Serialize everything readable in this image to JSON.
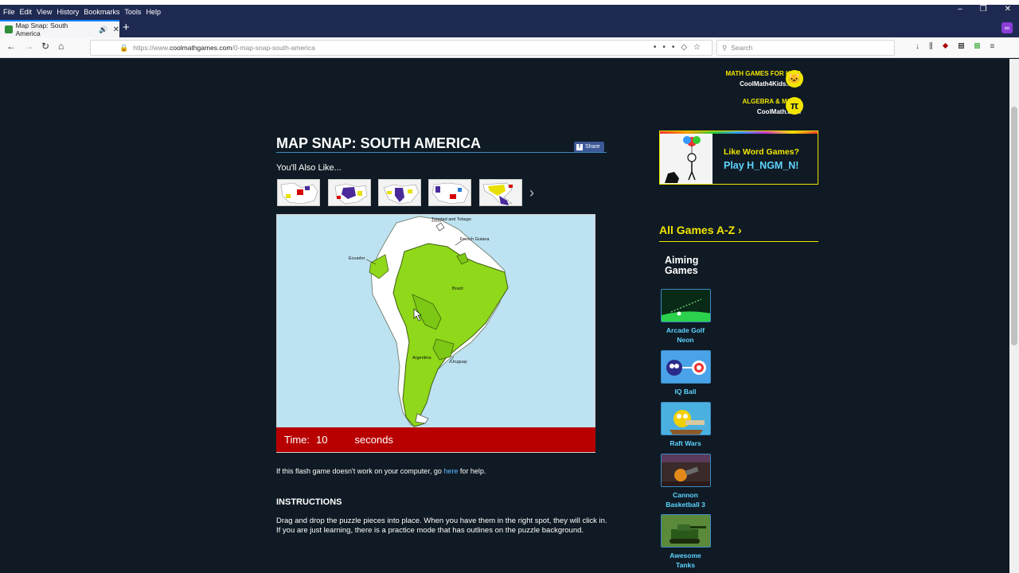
{
  "browser": {
    "menu": [
      "File",
      "Edit",
      "View",
      "History",
      "Bookmarks",
      "Tools",
      "Help"
    ],
    "tab_title": "Map Snap: South America",
    "url_prefix": "https://www.",
    "url_host": "coolmathgames.com",
    "url_path": "/0-map-snap-south-america",
    "search_placeholder": "Search"
  },
  "promos": {
    "kids_title": "MATH GAMES FOR KIDS",
    "kids_site": "CoolMath4Kids.com",
    "algebra_title": "ALGEBRA & MORE",
    "algebra_site": "CoolMath.com",
    "pi_symbol": "π"
  },
  "game": {
    "title": "MAP SNAP: SOUTH AMERICA",
    "share_label": "Share",
    "also_like": "You'll Also Like...",
    "map_labels": {
      "trinidad": "Trinidad and Tobago",
      "french_guiana": "French Guiana",
      "ecuador": "Ecuador",
      "brazil": "Brazil",
      "argentina": "Argentina",
      "uruguay": "Uruguay"
    },
    "timer_label": "Time:",
    "timer_value": "10",
    "timer_unit": "seconds",
    "help_text_before": "If this flash game doesn't work on your computer, go ",
    "help_link": "here",
    "help_text_after": " for help.",
    "instructions_heading": "INSTRUCTIONS",
    "instructions_1": "Drag and drop the puzzle pieces into place. When you have them in the right spot, they will click in.",
    "instructions_2": "If you are just learning, there is a practice mode that has outlines on the puzzle background."
  },
  "ad": {
    "line1": "Like Word Games?",
    "line2": "Play H_NGM_N!"
  },
  "sidebar": {
    "all_games": "All Games A-Z ›",
    "category": "Aiming Games",
    "games": [
      {
        "name": "Arcade Golf Neon"
      },
      {
        "name": "IQ Ball"
      },
      {
        "name": "Raft Wars"
      },
      {
        "name": "Cannon Basketball 3"
      },
      {
        "name": "Awesome Tanks"
      }
    ]
  },
  "colors": {
    "page_bg": "#0f1a24",
    "accent_yellow": "#f2e500",
    "link_blue": "#5fd4ff",
    "timer_red": "#b80000",
    "map_green": "#8fd81a",
    "ocean": "#bde2f2"
  }
}
